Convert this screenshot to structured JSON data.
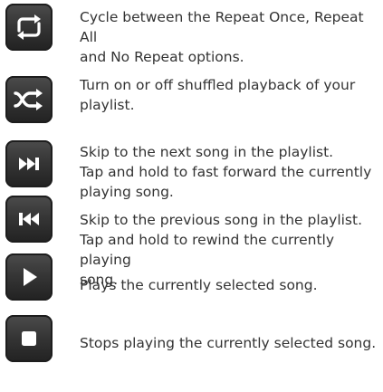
{
  "rows": [
    {
      "icon": "repeat-icon",
      "lines": [
        "Cycle between the Repeat Once, Repeat All",
        "and No Repeat options."
      ]
    },
    {
      "icon": "shuffle-icon",
      "lines": [
        "Turn on or off shuffled playback of your",
        "playlist."
      ]
    },
    {
      "icon": "next-track-icon",
      "lines": [
        "Skip to the next song in the playlist.",
        "Tap and hold to fast forward the currently",
        "playing song."
      ]
    },
    {
      "icon": "previous-track-icon",
      "lines": [
        "Skip to the previous song in the playlist.",
        "Tap and hold to rewind the currently playing",
        "song."
      ]
    },
    {
      "icon": "play-icon",
      "lines": [
        "Plays the currently selected song."
      ]
    },
    {
      "icon": "stop-icon",
      "lines": [
        "Stops playing the currently selected song."
      ]
    }
  ],
  "colors": {
    "button_dark": "#2f2f2f",
    "icon_white": "#ffffff",
    "text": "#333333"
  }
}
